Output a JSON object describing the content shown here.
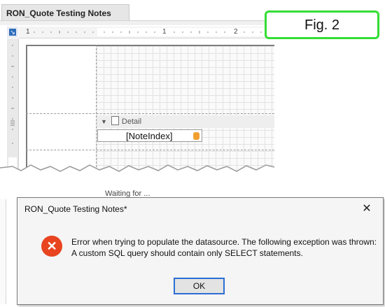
{
  "designer": {
    "tab_title": "RON_Quote Testing Notes",
    "ruler_numbers": [
      "1",
      "1",
      "2"
    ],
    "band_label": "Detail",
    "field_label": "[NoteIndex]"
  },
  "figure_label": "Fig. 2",
  "background_text": "Waiting for ... ",
  "dialog": {
    "title": "RON_Quote Testing Notes*",
    "close_glyph": "✕",
    "error_glyph": "✕",
    "message_line1": "Error when trying to populate the datasource. The following exception was thrown:",
    "message_line2": "A custom SQL query should contain only SELECT statements.",
    "ok_label": "OK"
  },
  "colors": {
    "figure_border": "#33dd33",
    "error_icon": "#e8441f",
    "ok_focus": "#2b6fd3",
    "db_icon": "#f0a030"
  }
}
